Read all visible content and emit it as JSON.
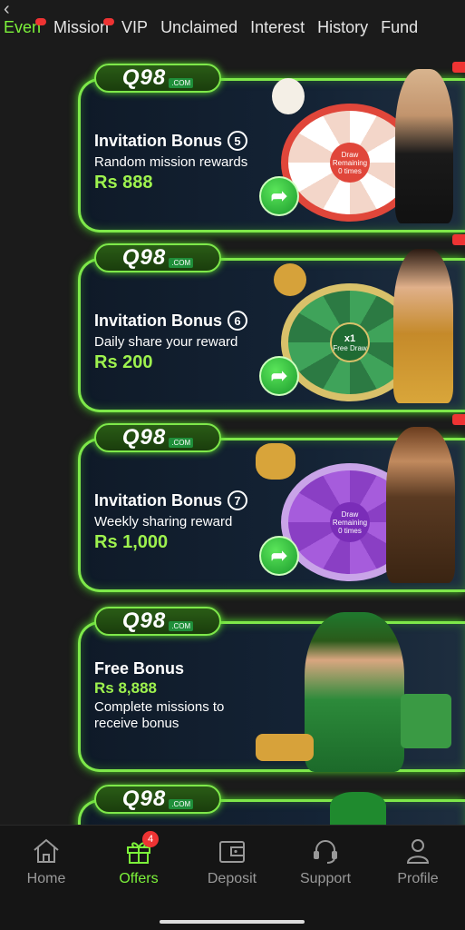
{
  "tabs": [
    "Even",
    "Mission",
    "VIP",
    "Unclaimed",
    "Interest",
    "History",
    "Fund"
  ],
  "banners": [
    {
      "logo": "Q98",
      "logo_com": ".COM",
      "title": "Invitation Bonus",
      "num": "5",
      "subtitle": "Random mission rewards",
      "amount": "Rs 888",
      "wheel_center": "Draw",
      "wheel_sub": "Remaining 0 times"
    },
    {
      "logo": "Q98",
      "logo_com": ".COM",
      "title": "Invitation Bonus",
      "num": "6",
      "subtitle": "Daily share your reward",
      "amount": "Rs 200",
      "wheel_center": "x1",
      "wheel_sub": "Free Draw"
    },
    {
      "logo": "Q98",
      "logo_com": ".COM",
      "title": "Invitation Bonus",
      "num": "7",
      "subtitle": "Weekly sharing reward",
      "amount": "Rs 1,000",
      "wheel_center": "Draw",
      "wheel_sub": "Remaining 0 times"
    }
  ],
  "free_bonus": {
    "logo": "Q98",
    "logo_com": ".COM",
    "title": "Free Bonus",
    "amount": "Rs 8,888",
    "description": "Complete missions to receive bonus"
  },
  "last_banner": {
    "logo": "Q98",
    "logo_com": ".COM"
  },
  "nav": {
    "home": "Home",
    "offers": "Offers",
    "offers_badge": "4",
    "deposit": "Deposit",
    "support": "Support",
    "profile": "Profile"
  },
  "colors": {
    "accent": "#7cf23a",
    "amount": "#9ef24e",
    "badge": "#ee3333"
  }
}
